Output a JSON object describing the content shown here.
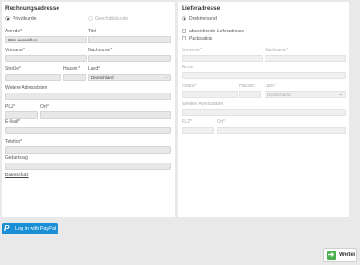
{
  "billing": {
    "heading": "Rechnungsadresse",
    "customer_type": {
      "private": "Privatkunde",
      "business": "Geschäftskunde"
    },
    "salutation": {
      "label": "Anrede*",
      "value": "Bitte auswählen"
    },
    "title": {
      "label": "Titel"
    },
    "firstname": {
      "label": "Vorname*"
    },
    "lastname": {
      "label": "Nachname*"
    },
    "street": {
      "label": "Straße*"
    },
    "housenumber": {
      "label": "Hausnr.*"
    },
    "country": {
      "label": "Land*",
      "value": "Deutschland"
    },
    "additional": {
      "label": "Weitere Adressdaten"
    },
    "zip": {
      "label": "PLZ*"
    },
    "city": {
      "label": "Ort*"
    },
    "email": {
      "label": "E-Mail*"
    },
    "phone": {
      "label": "Telefon*"
    },
    "birthday": {
      "label": "Geburtstag"
    },
    "privacy_link": "Datenschutz"
  },
  "shipping": {
    "heading": "Lieferadresse",
    "direct": "Direktversand",
    "other_address": "abweichende Lieferadresse",
    "packstation": "Packstation",
    "firstname": {
      "label": "Vorname*"
    },
    "lastname": {
      "label": "Nachname*"
    },
    "company": {
      "label": "Firma"
    },
    "street": {
      "label": "Straße*"
    },
    "housenumber": {
      "label": "Hausnr.*"
    },
    "country": {
      "label": "Land*",
      "value": "Deutschland"
    },
    "additional": {
      "label": "Weitere Adressdaten"
    },
    "zip": {
      "label": "PLZ*"
    },
    "city": {
      "label": "Ort*"
    }
  },
  "paypal_button": "Log in with PayPal",
  "next_button": "Weiter",
  "colors": {
    "paypal": "#1a8fd6",
    "next_arrow": "#4caf50"
  },
  "icons": {
    "paypal": "paypal-icon",
    "next": "arrow-right-icon"
  }
}
